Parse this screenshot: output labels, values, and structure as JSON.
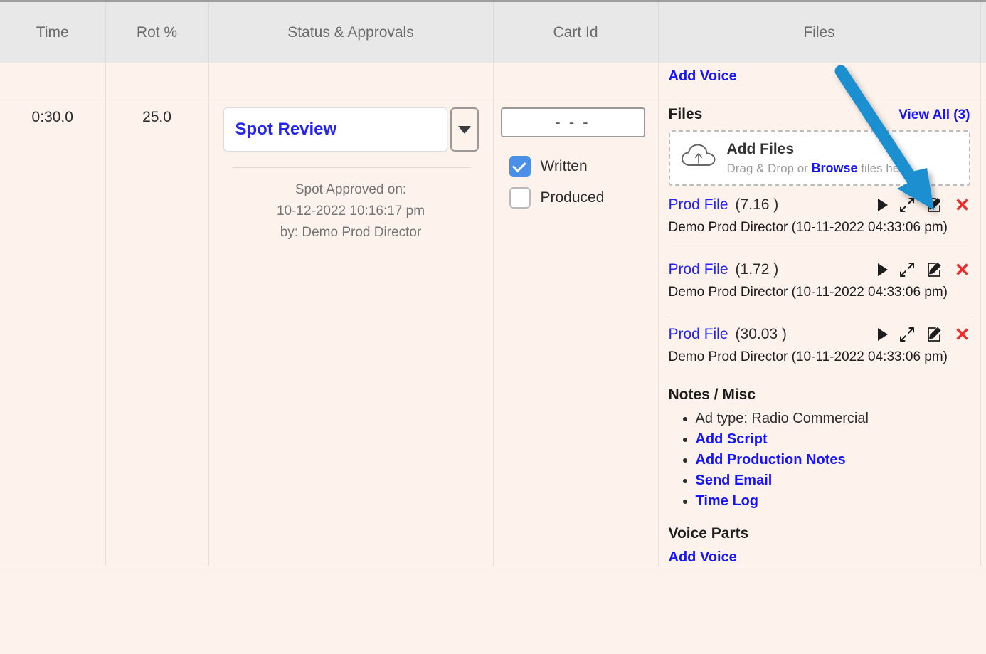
{
  "table": {
    "columns": [
      {
        "key": "time",
        "label": "Time"
      },
      {
        "key": "rot",
        "label": "Rot %"
      },
      {
        "key": "status",
        "label": "Status & Approvals"
      },
      {
        "key": "cart",
        "label": "Cart Id"
      },
      {
        "key": "files",
        "label": "Files"
      }
    ],
    "spacer_row": {
      "add_voice_label": "Add Voice"
    },
    "row": {
      "time": "0:30.0",
      "rot": "25.0"
    }
  },
  "status": {
    "select_value": "Spot Review",
    "dropdown_icon": "chevron-down-icon",
    "approved_label": "Spot Approved on:",
    "approved_datetime": "10-12-2022 10:16:17 pm",
    "approved_by": "by: Demo Prod Director"
  },
  "cart": {
    "input_value": "- - -",
    "checkboxes": [
      {
        "label": "Written",
        "checked": true
      },
      {
        "label": "Produced",
        "checked": false
      }
    ]
  },
  "files": {
    "section_title": "Files",
    "view_all_label": "View All (3)",
    "dropzone": {
      "icon": "cloud-upload-icon",
      "title": "Add Files",
      "prefix": "Drag & Drop or ",
      "browse_label": "Browse",
      "suffix": " files here"
    },
    "items": [
      {
        "name": "Prod File",
        "size": "(7.16 )",
        "meta": "Demo Prod Director (10-11-2022 04:33:06 pm)",
        "actions": [
          "play-icon",
          "expand-icon",
          "edit-pencil-icon",
          "delete-x-icon"
        ]
      },
      {
        "name": "Prod File",
        "size": "(1.72 )",
        "meta": "Demo Prod Director (10-11-2022 04:33:06 pm)",
        "actions": [
          "play-icon",
          "expand-icon",
          "edit-pencil-icon",
          "delete-x-icon"
        ]
      },
      {
        "name": "Prod File",
        "size": "(30.03 )",
        "meta": "Demo Prod Director (10-11-2022 04:33:06 pm)",
        "actions": [
          "play-icon",
          "expand-icon",
          "edit-pencil-icon",
          "delete-x-icon"
        ]
      }
    ],
    "notes": {
      "title": "Notes / Misc",
      "items": [
        {
          "text": "Ad type: Radio Commercial",
          "link": false
        },
        {
          "text": "Add Script",
          "link": true
        },
        {
          "text": "Add Production Notes",
          "link": true
        },
        {
          "text": "Send Email",
          "link": true
        },
        {
          "text": "Time Log",
          "link": true
        }
      ]
    },
    "voice_parts": {
      "title": "Voice Parts",
      "add_voice_label": "Add Voice"
    }
  },
  "annotation": {
    "type": "arrow",
    "color": "#1b8fd0",
    "target": "edit-pencil-icon of first Prod File"
  },
  "colors": {
    "row_background": "#fdf3ec",
    "header_background": "#e8e8e8",
    "link_blue": "#1414ff",
    "select_blue": "#2424f0",
    "checkbox_blue": "#4a90e8",
    "delete_red": "#ef2b2b",
    "arrow_blue": "#1b8fd0"
  }
}
